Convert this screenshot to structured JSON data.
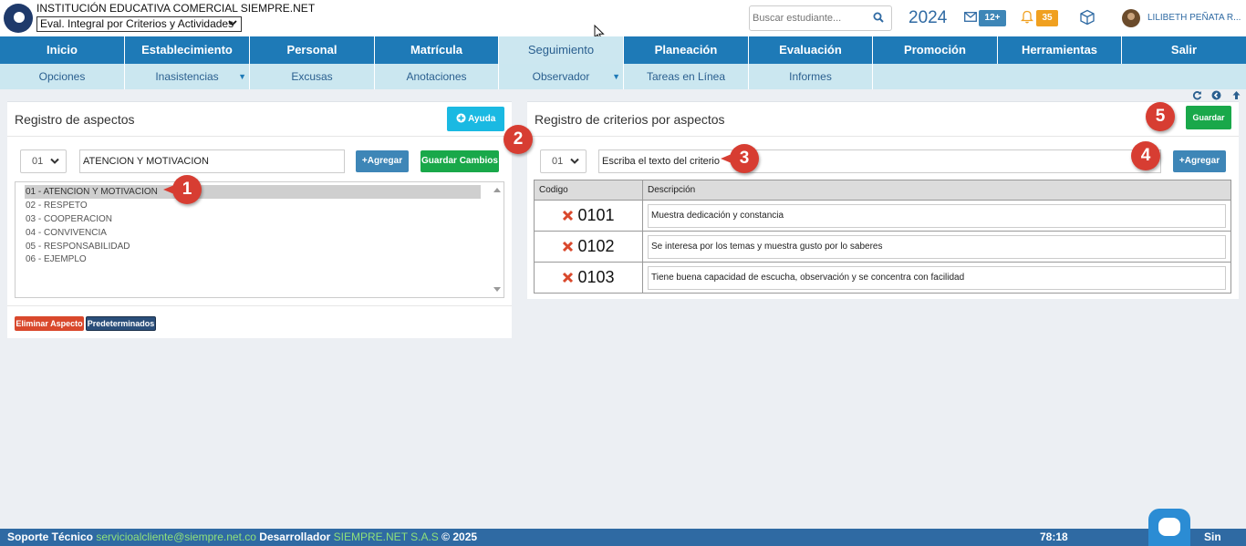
{
  "header": {
    "institution": "INSTITUCIÓN EDUCATIVA COMERCIAL SIEMPRE.NET",
    "module_select": "Eval. Integral por Criterios y Actividades",
    "search_placeholder": "Buscar estudiante...",
    "year": "2024",
    "mail_badge": "12+",
    "bell_badge": "35",
    "user": "LILIBETH PEÑATA R..."
  },
  "nav": {
    "items": [
      "Inicio",
      "Establecimiento",
      "Personal",
      "Matrícula",
      "Seguimiento",
      "Planeación",
      "Evaluación",
      "Promoción",
      "Herramientas",
      "Salir"
    ],
    "active": "Seguimiento"
  },
  "subnav": {
    "items": [
      "Opciones",
      "Inasistencias",
      "Excusas",
      "Anotaciones",
      "Observador",
      "Tareas en Línea",
      "Informes"
    ]
  },
  "left_panel": {
    "title": "Registro de aspectos",
    "help_button": "Ayuda",
    "select_value": "01",
    "input_value": "ATENCION Y MOTIVACION",
    "add_button": "Agregar",
    "save_changes_button": "Guardar Cambios",
    "aspects": [
      "01 - ATENCION Y MOTIVACION",
      "02 - RESPETO",
      "03 - COOPERACION",
      "04 - CONVIVENCIA",
      "05 - RESPONSABILIDAD",
      "06 - EJEMPLO"
    ],
    "delete_button": "Eliminar Aspecto",
    "defaults_button": "Predeterminados"
  },
  "right_panel": {
    "title": "Registro de criterios por aspectos",
    "save_button": "Guardar",
    "select_value": "01",
    "input_placeholder": "Escriba el texto del criterio",
    "add_button": "Agregar",
    "columns": [
      "Codigo",
      "Descripción"
    ],
    "rows": [
      {
        "code": "0101",
        "description": "Muestra dedicación y constancia"
      },
      {
        "code": "0102",
        "description": "Se interesa por los temas y muestra gusto por lo saberes"
      },
      {
        "code": "0103",
        "description": "Tiene buena capacidad de escucha, observación y se concentra con facilidad"
      }
    ]
  },
  "steps": [
    "1",
    "2",
    "3",
    "4",
    "5"
  ],
  "footer": {
    "support_label": "Soporte Técnico",
    "support_email": "servicioalcliente@siempre.net.co",
    "developer_label": "Desarrollador",
    "developer": "SIEMPRE.NET S.A.S",
    "copyright": "© 2025",
    "timer": "78:18",
    "brand": "Sin"
  },
  "colors": {
    "nav_blue": "#1e7ab7",
    "subnav": "#cbe7f0",
    "green": "#19a84a",
    "red": "#d9482c",
    "step_red": "#d73d32"
  }
}
